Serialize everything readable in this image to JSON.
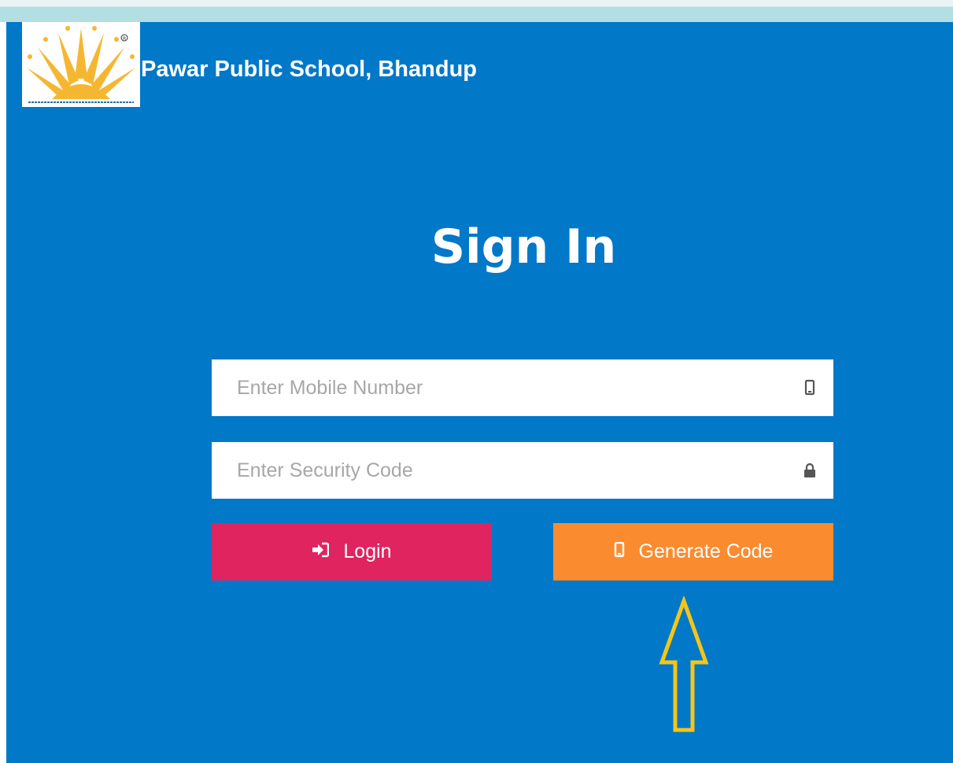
{
  "header": {
    "school_name": "Pawar Public School, Bhandup",
    "logo_icon": "sunburst-logo",
    "logo_tagline": "Together we can make a difference"
  },
  "signin": {
    "title": "Sign In"
  },
  "form": {
    "mobile": {
      "placeholder": "Enter Mobile Number",
      "value": "",
      "icon": "mobile-phone-icon"
    },
    "security_code": {
      "placeholder": "Enter Security Code",
      "value": "",
      "icon": "lock-icon"
    }
  },
  "buttons": {
    "login": {
      "label": "Login",
      "icon": "sign-in-icon",
      "color": "#df2460"
    },
    "generate_code": {
      "label": "Generate Code",
      "icon": "mobile-phone-icon",
      "color": "#fb8b2f"
    }
  },
  "annotation": {
    "icon": "up-arrow-outline-icon",
    "color": "#f5c518"
  },
  "colors": {
    "panel_background": "#0178c8",
    "top_strip": "#b4dfe2"
  }
}
